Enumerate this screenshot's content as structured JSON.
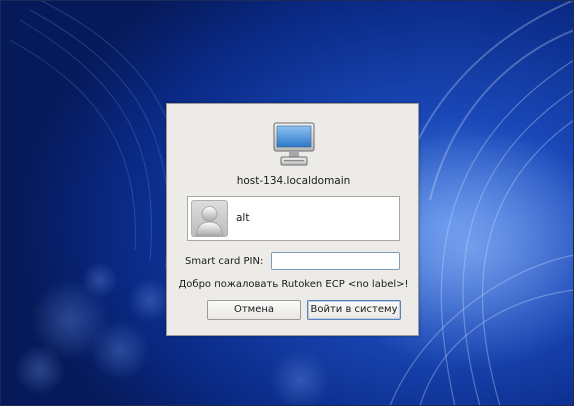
{
  "login_dialog": {
    "hostname": "host-134.localdomain",
    "users": [
      {
        "name": "alt"
      }
    ],
    "pin": {
      "label": "Smart card PIN:",
      "value": "",
      "placeholder": ""
    },
    "message": "Добро пожаловать Rutoken ECP <no label>!",
    "buttons": {
      "cancel_label": "Отмена",
      "login_label": "Войти в систему"
    }
  },
  "icons": {
    "computer": "computer-icon",
    "avatar": "user-avatar-icon"
  },
  "colors": {
    "wallpaper_base": "#0a2d8a",
    "dialog_background": "#edebe7",
    "input_border": "#7f9db9",
    "default_button_border": "#5c7fb5"
  }
}
